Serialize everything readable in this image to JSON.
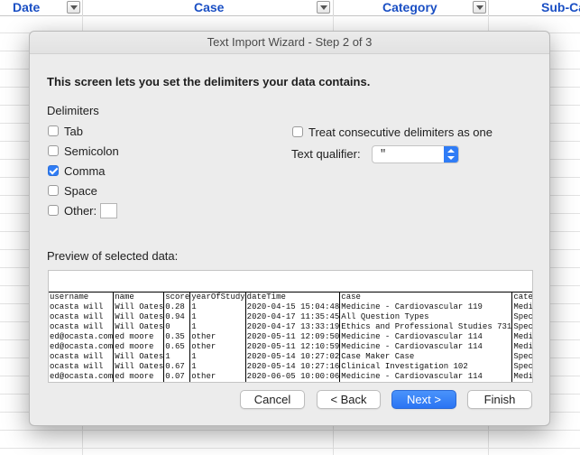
{
  "sheet": {
    "columns": [
      {
        "label": "Date"
      },
      {
        "label": "Case"
      },
      {
        "label": "Category"
      },
      {
        "label": "Sub-Ca"
      }
    ]
  },
  "dialog": {
    "title": "Text Import Wizard - Step 2 of 3",
    "heading": "This screen lets you set the delimiters your data contains.",
    "delimiters_label": "Delimiters",
    "delimiters": [
      {
        "label": "Tab",
        "checked": false
      },
      {
        "label": "Semicolon",
        "checked": false
      },
      {
        "label": "Comma",
        "checked": true
      },
      {
        "label": "Space",
        "checked": false
      },
      {
        "label": "Other:",
        "checked": false
      }
    ],
    "other_value": "",
    "consecutive_label": "Treat consecutive delimiters as one",
    "consecutive_checked": false,
    "qualifier_label": "Text qualifier:",
    "qualifier_value": "\"",
    "preview_label": "Preview of selected data:",
    "preview": {
      "columns": [
        "username",
        "name",
        "score",
        "yearOfStudy",
        "dateTime",
        "case",
        "category"
      ],
      "rows": [
        [
          "ocasta will",
          "Will Oates",
          "0.28",
          "1",
          "2020-04-15 15:04:48",
          "Medicine - Cardiovascular 119",
          "Medicine"
        ],
        [
          "ocasta will",
          "Will Oates",
          "0.94",
          "1",
          "2020-04-17 11:35:45",
          "All Question Types",
          "Specialt"
        ],
        [
          "ocasta will",
          "Will Oates",
          "0",
          "1",
          "2020-04-17 13:33:19",
          "Ethics and Professional Studies 731",
          "Specialt"
        ],
        [
          "ed@ocasta.com",
          "ed moore",
          "0.35",
          "other",
          "2020-05-11 12:09:50",
          "Medicine - Cardiovascular 114",
          "Medicine"
        ],
        [
          "ed@ocasta.com",
          "ed moore",
          "0.65",
          "other",
          "2020-05-11 12:10:59",
          "Medicine - Cardiovascular 114",
          "Medicine"
        ],
        [
          "ocasta will",
          "Will Oates",
          "1",
          "1",
          "2020-05-14 10:27:02",
          "Case Maker Case",
          "Specialt"
        ],
        [
          "ocasta will",
          "Will Oates",
          "0.67",
          "1",
          "2020-05-14 10:27:16",
          "Clinical Investigation 102",
          "Specialt"
        ],
        [
          "ed@ocasta.com",
          "ed moore",
          "0.07",
          "other",
          "2020-06-05 10:00:06",
          "Medicine - Cardiovascular 114",
          "Medicine"
        ]
      ]
    },
    "buttons": {
      "cancel": "Cancel",
      "back": "< Back",
      "next": "Next >",
      "finish": "Finish"
    }
  }
}
